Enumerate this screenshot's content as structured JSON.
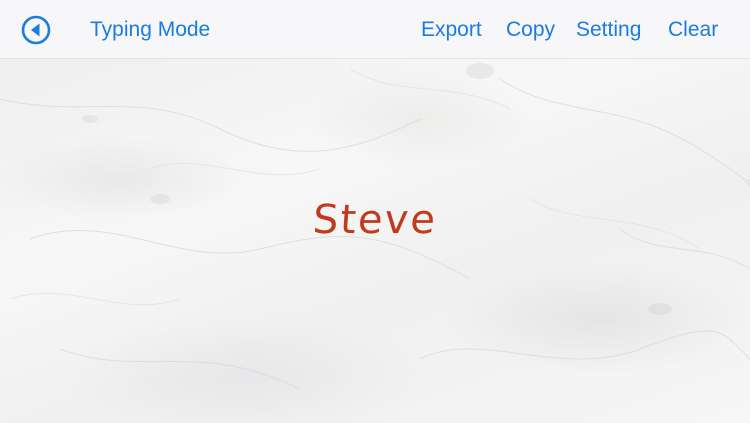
{
  "colors": {
    "accent": "#1a7ce0",
    "ink": "#c23a1c",
    "toolbar_bg": "#f7f7f9"
  },
  "toolbar": {
    "back_icon": "back-arrow-circle-icon",
    "mode_label": "Typing Mode",
    "export_label": "Export",
    "copy_label": "Copy",
    "setting_label": "Setting",
    "clear_label": "Clear"
  },
  "canvas": {
    "background": "white marble texture",
    "text": "Steve"
  }
}
